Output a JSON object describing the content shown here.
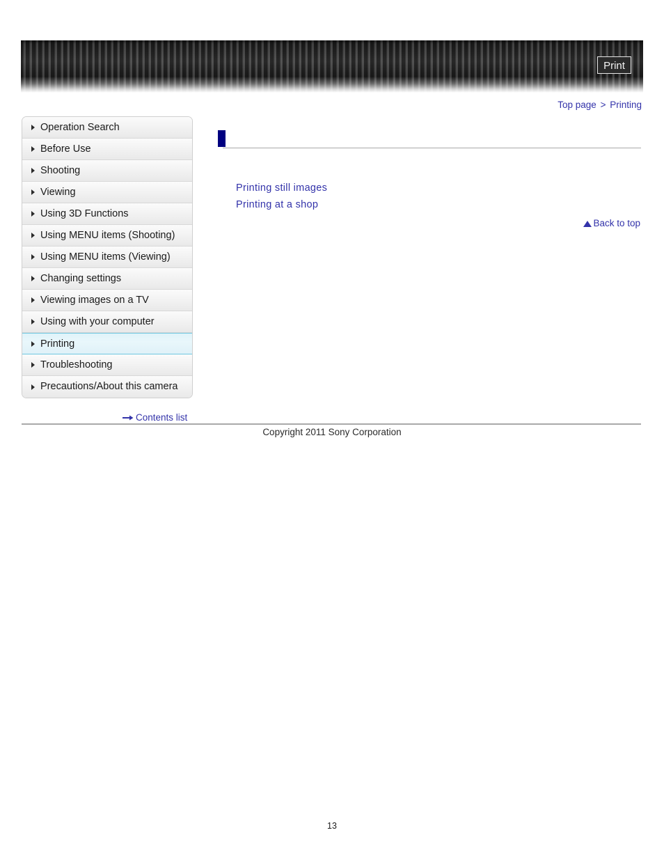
{
  "header": {
    "print_label": "Print"
  },
  "breadcrumb": {
    "top_page": "Top page",
    "separator": ">",
    "current": "Printing"
  },
  "sidebar": {
    "items": [
      {
        "label": "Operation Search",
        "selected": false
      },
      {
        "label": "Before Use",
        "selected": false
      },
      {
        "label": "Shooting",
        "selected": false
      },
      {
        "label": "Viewing",
        "selected": false
      },
      {
        "label": "Using 3D Functions",
        "selected": false
      },
      {
        "label": "Using MENU items (Shooting)",
        "selected": false
      },
      {
        "label": "Using MENU items (Viewing)",
        "selected": false
      },
      {
        "label": "Changing settings",
        "selected": false
      },
      {
        "label": "Viewing images on a TV",
        "selected": false
      },
      {
        "label": "Using with your computer",
        "selected": false
      },
      {
        "label": "Printing",
        "selected": true
      },
      {
        "label": "Troubleshooting",
        "selected": false
      },
      {
        "label": "Precautions/About this camera",
        "selected": false
      }
    ],
    "contents_list_label": "Contents list"
  },
  "main": {
    "title": "",
    "links": [
      "Printing still images",
      "Printing at a shop"
    ],
    "back_to_top_label": "Back to top"
  },
  "footer": {
    "copyright": "Copyright 2011 Sony Corporation",
    "page_number": "13"
  },
  "colors": {
    "link_blue": "#3333aa",
    "title_navy": "#000080",
    "selected_border": "#6fc8e0",
    "rule_gray": "#a9a9a9"
  }
}
